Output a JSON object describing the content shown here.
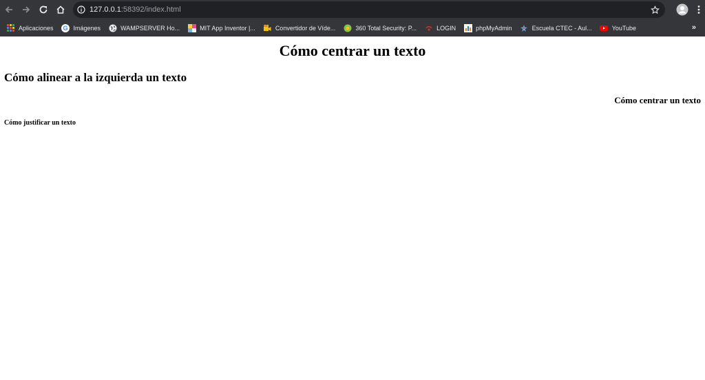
{
  "browser": {
    "url_host": "127.0.0.1",
    "url_rest": ":58392/index.html",
    "bookmarks": [
      {
        "label": "Aplicaciones",
        "icon": "apps-grid-icon"
      },
      {
        "label": "Imágenes",
        "icon": "google-icon"
      },
      {
        "label": "WAMPSERVER Ho...",
        "icon": "globe-icon"
      },
      {
        "label": "MIT App Inventor |...",
        "icon": "mit-app-inventor-icon"
      },
      {
        "label": "Convertidor de Víde...",
        "icon": "video-converter-icon"
      },
      {
        "label": "360 Total Security: P...",
        "icon": "360-security-icon"
      },
      {
        "label": "LOGIN",
        "icon": "login-icon"
      },
      {
        "label": "phpMyAdmin",
        "icon": "phpmyadmin-icon"
      },
      {
        "label": "Escuela CTEC - Aul...",
        "icon": "ctec-icon"
      },
      {
        "label": "YouTube",
        "icon": "youtube-icon"
      }
    ],
    "more_label": "»"
  },
  "page": {
    "h1": "Cómo centrar un texto",
    "h2": "Cómo alinear a la izquierda un texto",
    "h3": "Cómo centrar un texto",
    "h4": "Cómo justificar un texto"
  },
  "colors": {
    "chrome_bg": "#35363a",
    "omnibox_bg": "#202124",
    "page_bg": "#ffffff",
    "text": "#000000"
  }
}
